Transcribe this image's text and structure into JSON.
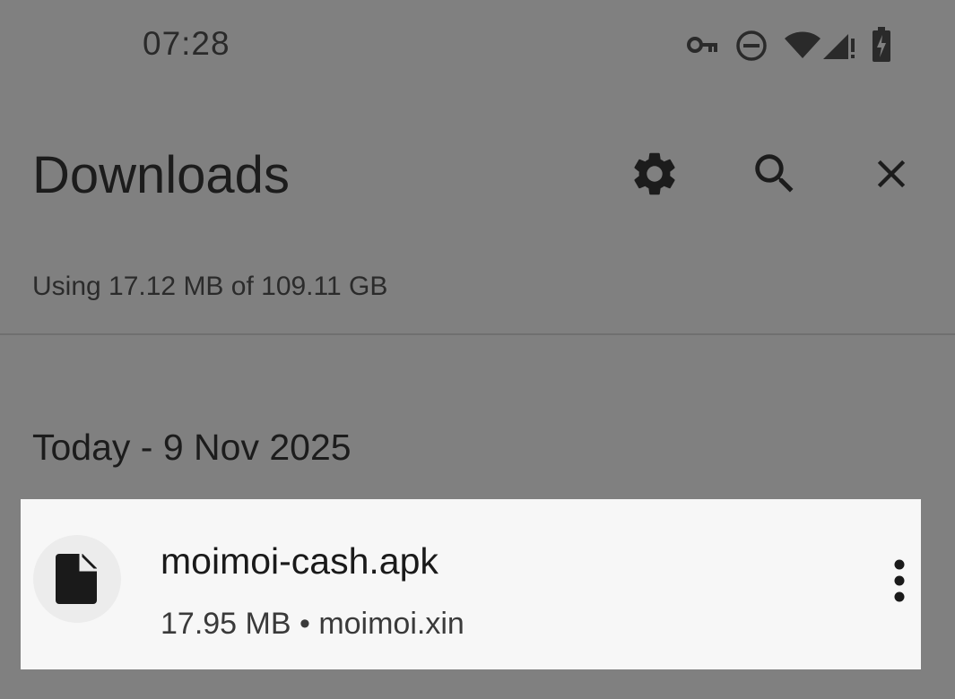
{
  "status_bar": {
    "time": "07:28",
    "icons": [
      "vpn-key-icon",
      "do-not-disturb-icon",
      "wifi-icon",
      "cell-signal-icon",
      "battery-charging-icon"
    ]
  },
  "app_bar": {
    "title": "Downloads",
    "actions": [
      "gear-icon",
      "search-icon",
      "close-icon"
    ]
  },
  "storage": {
    "text": "Using 17.12 MB of 109.11 GB"
  },
  "section": {
    "header": "Today - 9 Nov 2025"
  },
  "downloads": [
    {
      "file_name": "moimoi-cash.apk",
      "meta": "17.95 MB • moimoi.xin",
      "icon": "file-icon",
      "menu_icon": "more-vert-icon"
    }
  ]
}
